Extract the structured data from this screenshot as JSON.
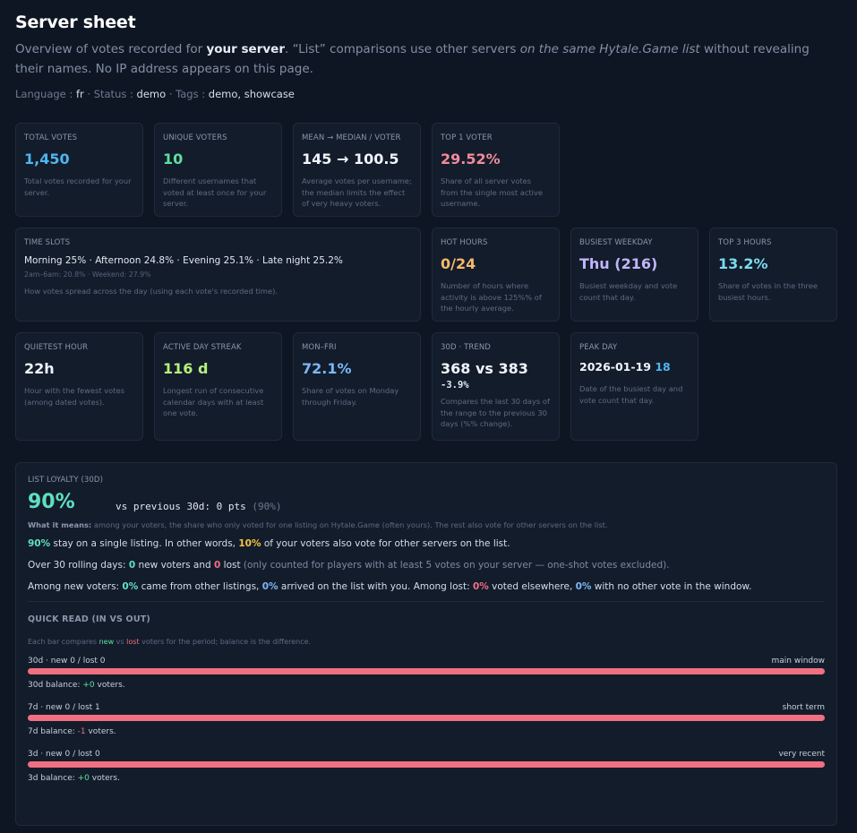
{
  "header": {
    "title": "Server sheet",
    "intro_prefix": "Overview of votes recorded for ",
    "intro_bold": "your server",
    "intro_mid": ". “List” comparisons use other servers ",
    "intro_italic": "on the same Hytale.Game list",
    "intro_suffix": " without revealing their names. No IP address appears on this page.",
    "language_label": "Language : ",
    "language_value": "fr",
    "status_label": " · Status : ",
    "status_value": "demo",
    "tags_label": " · Tags : ",
    "tags_value": "demo, showcase"
  },
  "cards": {
    "total_votes": {
      "label": "TOTAL VOTES",
      "value": "1,450",
      "desc": "Total votes recorded for your server."
    },
    "unique_voters": {
      "label": "UNIQUE VOTERS",
      "value": "10",
      "desc": "Different usernames that voted at least once for your server."
    },
    "mean_median": {
      "label": "MEAN → MEDIAN / VOTER",
      "value": "145 → 100.5",
      "desc": "Average votes per username; the median limits the effect of very heavy voters."
    },
    "top_voter": {
      "label": "TOP 1 VOTER",
      "value": "29.52%",
      "desc": "Share of all server votes from the single most active username."
    },
    "time_slots": {
      "label": "TIME SLOTS",
      "line": "Morning 25% · Afternoon 24.8% · Evening 25.1% · Late night 25.2%",
      "sub": "2am–6am: 20.8% · Weekend: 27.9%",
      "desc": "How votes spread across the day (using each vote's recorded time)."
    },
    "hot_hours": {
      "label": "HOT HOURS",
      "value": "0/24",
      "desc": "Number of hours where activity is above 125%% of the hourly average."
    },
    "busiest_weekday": {
      "label": "BUSIEST WEEKDAY",
      "value": "Thu (216)",
      "desc": "Busiest weekday and vote count that day."
    },
    "top3_hours": {
      "label": "TOP 3 HOURS",
      "value": "13.2%",
      "desc": "Share of votes in the three busiest hours."
    },
    "quietest_hour": {
      "label": "QUIETEST HOUR",
      "value": "22h",
      "desc": "Hour with the fewest votes (among dated votes)."
    },
    "active_streak": {
      "label": "ACTIVE DAY STREAK",
      "value": "116 d",
      "desc": "Longest run of consecutive calendar days with at least one vote."
    },
    "mon_fri": {
      "label": "MON–FRI",
      "value": "72.1%",
      "desc": "Share of votes on Monday through Friday."
    },
    "trend": {
      "label": "30D · TREND",
      "value": "368 vs 383",
      "sub": "-3.9%",
      "desc": "Compares the last 30 days of the range to the previous 30 days (%% change)."
    },
    "peak_day": {
      "label": "PEAK DAY",
      "date": "2026-01-19",
      "count": "18",
      "desc": "Date of the busiest day and vote count that day."
    }
  },
  "loyalty": {
    "label": "LIST LOYALTY (30D)",
    "value": "90%",
    "vs_text": "vs previous 30d: 0 pts",
    "vs_paren": "(90%)",
    "what_label": "What it means:",
    "what_text": " among your voters, the share who only voted for one listing on Hytale.Game (often yours). The rest also vote for other servers on the list.",
    "p1_a": "90%",
    "p1_b": " stay on a single listing. In other words, ",
    "p1_c": "10%",
    "p1_d": " of your voters also vote for other servers on the list.",
    "p2_a": "Over 30 rolling days: ",
    "p2_b": "0",
    "p2_c": " new voters and ",
    "p2_d": "0",
    "p2_e": " lost",
    "p2_f": " (only counted for players with at least 5 votes on your server — one-shot votes excluded).",
    "p3_a": "Among new voters: ",
    "p3_b": "0%",
    "p3_c": " came from other listings, ",
    "p3_d": "0%",
    "p3_e": " arrived on the list with you. Among lost: ",
    "p3_f": "0%",
    "p3_g": " voted elsewhere, ",
    "p3_h": "0%",
    "p3_i": " with no other vote in the window."
  },
  "quick_read": {
    "title": "QUICK READ (IN VS OUT)",
    "desc_a": "Each bar compares ",
    "desc_new": "new",
    "desc_vs": " vs ",
    "desc_lost": "lost",
    "desc_b": " voters for the period; balance is the difference.",
    "rows": [
      {
        "left": "30d · new 0 / lost 0",
        "right": "main window",
        "balance_label": "30d balance: ",
        "balance": "+0",
        "balance_unit": " voters.",
        "new_frac": 0,
        "lost_frac": 1
      },
      {
        "left": "7d · new 0 / lost 1",
        "right": "short term",
        "balance_label": "7d balance: ",
        "balance": "-1",
        "balance_unit": " voters.",
        "new_frac": 0,
        "lost_frac": 1
      },
      {
        "left": "3d · new 0 / lost 0",
        "right": "very recent",
        "balance_label": "3d balance: ",
        "balance": "+0",
        "balance_unit": " voters.",
        "new_frac": 0,
        "lost_frac": 1
      }
    ]
  },
  "colors": {
    "background": "#0f1623",
    "card": "#131c2b",
    "new": "#5ee0a0",
    "lost": "#f06f80"
  }
}
